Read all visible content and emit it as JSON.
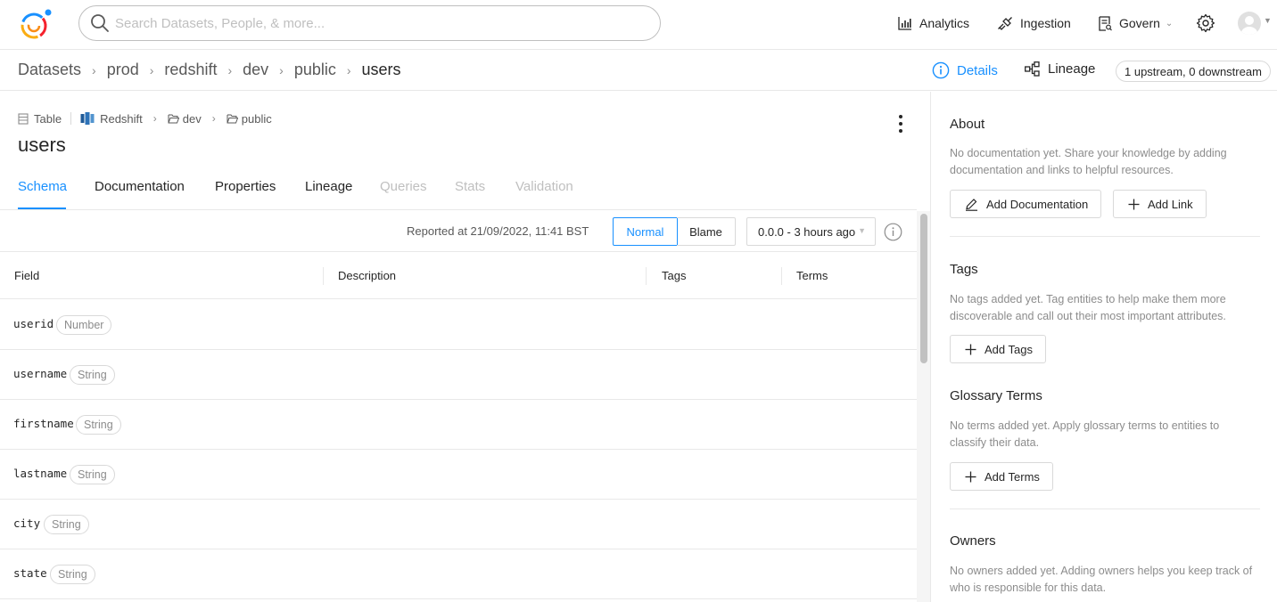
{
  "topnav": {
    "search_placeholder": "Search Datasets, People, & more...",
    "analytics": "Analytics",
    "ingestion": "Ingestion",
    "govern": "Govern"
  },
  "breadcrumb": {
    "items": [
      "Datasets",
      "prod",
      "redshift",
      "dev",
      "public",
      "users"
    ]
  },
  "header_actions": {
    "details": "Details",
    "lineage": "Lineage",
    "lineage_count": "1 upstream, 0 downstream"
  },
  "entity": {
    "type": "Table",
    "platform": "Redshift",
    "path": [
      "dev",
      "public"
    ],
    "name": "users"
  },
  "tabs": [
    {
      "label": "Schema",
      "state": "active"
    },
    {
      "label": "Documentation",
      "state": "enabled"
    },
    {
      "label": "Properties",
      "state": "enabled"
    },
    {
      "label": "Lineage",
      "state": "enabled"
    },
    {
      "label": "Queries",
      "state": "disabled"
    },
    {
      "label": "Stats",
      "state": "disabled"
    },
    {
      "label": "Validation",
      "state": "disabled"
    }
  ],
  "schema_toolbar": {
    "reported": "Reported at 21/09/2022, 11:41 BST",
    "mode_normal": "Normal",
    "mode_blame": "Blame",
    "version": "0.0.0 - 3 hours ago"
  },
  "schema_table": {
    "columns": [
      "Field",
      "Description",
      "Tags",
      "Terms"
    ],
    "rows": [
      {
        "field": "userid",
        "type": "Number"
      },
      {
        "field": "username",
        "type": "String"
      },
      {
        "field": "firstname",
        "type": "String"
      },
      {
        "field": "lastname",
        "type": "String"
      },
      {
        "field": "city",
        "type": "String"
      },
      {
        "field": "state",
        "type": "String"
      }
    ]
  },
  "sidebar": {
    "about": {
      "title": "About",
      "text": "No documentation yet. Share your knowledge by adding documentation and links to helpful resources.",
      "add_doc": "Add Documentation",
      "add_link": "Add Link"
    },
    "tags": {
      "title": "Tags",
      "text": "No tags added yet. Tag entities to help make them more discoverable and call out their most important attributes.",
      "add": "Add Tags"
    },
    "terms": {
      "title": "Glossary Terms",
      "text": "No terms added yet. Apply glossary terms to entities to classify their data.",
      "add": "Add Terms"
    },
    "owners": {
      "title": "Owners",
      "text": "No owners added yet. Adding owners helps you keep track of who is responsible for this data."
    }
  },
  "colors": {
    "accent": "#1890ff",
    "text": "#262626",
    "muted": "#8c8c8c",
    "border": "#e8e8e8"
  }
}
